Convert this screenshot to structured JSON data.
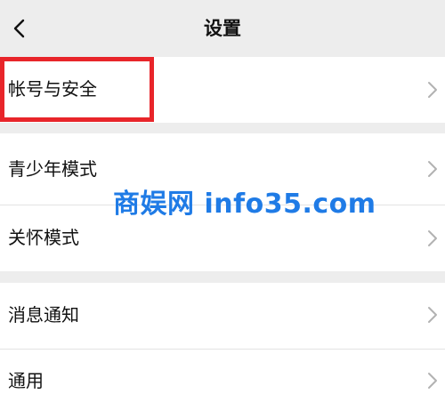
{
  "header": {
    "title": "设置"
  },
  "sections": [
    {
      "items": [
        {
          "label": "帐号与安全",
          "highlighted": true
        }
      ]
    },
    {
      "items": [
        {
          "label": "青少年模式"
        },
        {
          "label": "关怀模式"
        }
      ]
    },
    {
      "items": [
        {
          "label": "消息通知"
        },
        {
          "label": "通用"
        }
      ]
    }
  ],
  "watermark": {
    "text": "商娱网 info35.com"
  },
  "colors": {
    "background": "#ededed",
    "row_background": "#ffffff",
    "highlight": "#e8252a",
    "watermark": "#1f7be6",
    "chevron": "#b2b2b2"
  },
  "icons": {
    "back": "chevron-left-icon",
    "row_arrow": "chevron-right-icon"
  }
}
